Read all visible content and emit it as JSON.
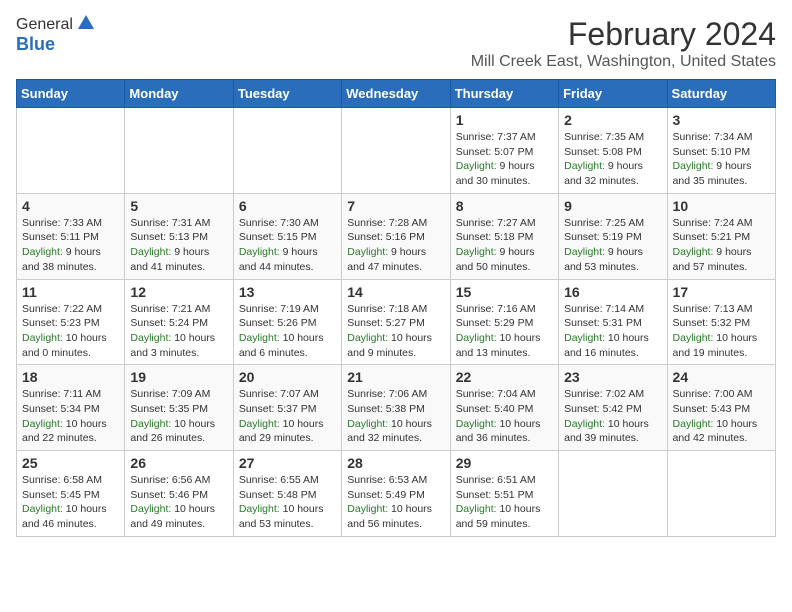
{
  "header": {
    "logo": {
      "line1": "General",
      "line2": "Blue"
    },
    "title": "February 2024",
    "subtitle": "Mill Creek East, Washington, United States"
  },
  "columns": [
    "Sunday",
    "Monday",
    "Tuesday",
    "Wednesday",
    "Thursday",
    "Friday",
    "Saturday"
  ],
  "weeks": [
    [
      {
        "day": "",
        "sunrise": "",
        "sunset": "",
        "daylight": ""
      },
      {
        "day": "",
        "sunrise": "",
        "sunset": "",
        "daylight": ""
      },
      {
        "day": "",
        "sunrise": "",
        "sunset": "",
        "daylight": ""
      },
      {
        "day": "",
        "sunrise": "",
        "sunset": "",
        "daylight": ""
      },
      {
        "day": "1",
        "sunrise": "Sunrise: 7:37 AM",
        "sunset": "Sunset: 5:07 PM",
        "daylight": "Daylight: 9 hours and 30 minutes."
      },
      {
        "day": "2",
        "sunrise": "Sunrise: 7:35 AM",
        "sunset": "Sunset: 5:08 PM",
        "daylight": "Daylight: 9 hours and 32 minutes."
      },
      {
        "day": "3",
        "sunrise": "Sunrise: 7:34 AM",
        "sunset": "Sunset: 5:10 PM",
        "daylight": "Daylight: 9 hours and 35 minutes."
      }
    ],
    [
      {
        "day": "4",
        "sunrise": "Sunrise: 7:33 AM",
        "sunset": "Sunset: 5:11 PM",
        "daylight": "Daylight: 9 hours and 38 minutes."
      },
      {
        "day": "5",
        "sunrise": "Sunrise: 7:31 AM",
        "sunset": "Sunset: 5:13 PM",
        "daylight": "Daylight: 9 hours and 41 minutes."
      },
      {
        "day": "6",
        "sunrise": "Sunrise: 7:30 AM",
        "sunset": "Sunset: 5:15 PM",
        "daylight": "Daylight: 9 hours and 44 minutes."
      },
      {
        "day": "7",
        "sunrise": "Sunrise: 7:28 AM",
        "sunset": "Sunset: 5:16 PM",
        "daylight": "Daylight: 9 hours and 47 minutes."
      },
      {
        "day": "8",
        "sunrise": "Sunrise: 7:27 AM",
        "sunset": "Sunset: 5:18 PM",
        "daylight": "Daylight: 9 hours and 50 minutes."
      },
      {
        "day": "9",
        "sunrise": "Sunrise: 7:25 AM",
        "sunset": "Sunset: 5:19 PM",
        "daylight": "Daylight: 9 hours and 53 minutes."
      },
      {
        "day": "10",
        "sunrise": "Sunrise: 7:24 AM",
        "sunset": "Sunset: 5:21 PM",
        "daylight": "Daylight: 9 hours and 57 minutes."
      }
    ],
    [
      {
        "day": "11",
        "sunrise": "Sunrise: 7:22 AM",
        "sunset": "Sunset: 5:23 PM",
        "daylight": "Daylight: 10 hours and 0 minutes."
      },
      {
        "day": "12",
        "sunrise": "Sunrise: 7:21 AM",
        "sunset": "Sunset: 5:24 PM",
        "daylight": "Daylight: 10 hours and 3 minutes."
      },
      {
        "day": "13",
        "sunrise": "Sunrise: 7:19 AM",
        "sunset": "Sunset: 5:26 PM",
        "daylight": "Daylight: 10 hours and 6 minutes."
      },
      {
        "day": "14",
        "sunrise": "Sunrise: 7:18 AM",
        "sunset": "Sunset: 5:27 PM",
        "daylight": "Daylight: 10 hours and 9 minutes."
      },
      {
        "day": "15",
        "sunrise": "Sunrise: 7:16 AM",
        "sunset": "Sunset: 5:29 PM",
        "daylight": "Daylight: 10 hours and 13 minutes."
      },
      {
        "day": "16",
        "sunrise": "Sunrise: 7:14 AM",
        "sunset": "Sunset: 5:31 PM",
        "daylight": "Daylight: 10 hours and 16 minutes."
      },
      {
        "day": "17",
        "sunrise": "Sunrise: 7:13 AM",
        "sunset": "Sunset: 5:32 PM",
        "daylight": "Daylight: 10 hours and 19 minutes."
      }
    ],
    [
      {
        "day": "18",
        "sunrise": "Sunrise: 7:11 AM",
        "sunset": "Sunset: 5:34 PM",
        "daylight": "Daylight: 10 hours and 22 minutes."
      },
      {
        "day": "19",
        "sunrise": "Sunrise: 7:09 AM",
        "sunset": "Sunset: 5:35 PM",
        "daylight": "Daylight: 10 hours and 26 minutes."
      },
      {
        "day": "20",
        "sunrise": "Sunrise: 7:07 AM",
        "sunset": "Sunset: 5:37 PM",
        "daylight": "Daylight: 10 hours and 29 minutes."
      },
      {
        "day": "21",
        "sunrise": "Sunrise: 7:06 AM",
        "sunset": "Sunset: 5:38 PM",
        "daylight": "Daylight: 10 hours and 32 minutes."
      },
      {
        "day": "22",
        "sunrise": "Sunrise: 7:04 AM",
        "sunset": "Sunset: 5:40 PM",
        "daylight": "Daylight: 10 hours and 36 minutes."
      },
      {
        "day": "23",
        "sunrise": "Sunrise: 7:02 AM",
        "sunset": "Sunset: 5:42 PM",
        "daylight": "Daylight: 10 hours and 39 minutes."
      },
      {
        "day": "24",
        "sunrise": "Sunrise: 7:00 AM",
        "sunset": "Sunset: 5:43 PM",
        "daylight": "Daylight: 10 hours and 42 minutes."
      }
    ],
    [
      {
        "day": "25",
        "sunrise": "Sunrise: 6:58 AM",
        "sunset": "Sunset: 5:45 PM",
        "daylight": "Daylight: 10 hours and 46 minutes."
      },
      {
        "day": "26",
        "sunrise": "Sunrise: 6:56 AM",
        "sunset": "Sunset: 5:46 PM",
        "daylight": "Daylight: 10 hours and 49 minutes."
      },
      {
        "day": "27",
        "sunrise": "Sunrise: 6:55 AM",
        "sunset": "Sunset: 5:48 PM",
        "daylight": "Daylight: 10 hours and 53 minutes."
      },
      {
        "day": "28",
        "sunrise": "Sunrise: 6:53 AM",
        "sunset": "Sunset: 5:49 PM",
        "daylight": "Daylight: 10 hours and 56 minutes."
      },
      {
        "day": "29",
        "sunrise": "Sunrise: 6:51 AM",
        "sunset": "Sunset: 5:51 PM",
        "daylight": "Daylight: 10 hours and 59 minutes."
      },
      {
        "day": "",
        "sunrise": "",
        "sunset": "",
        "daylight": ""
      },
      {
        "day": "",
        "sunrise": "",
        "sunset": "",
        "daylight": ""
      }
    ]
  ]
}
